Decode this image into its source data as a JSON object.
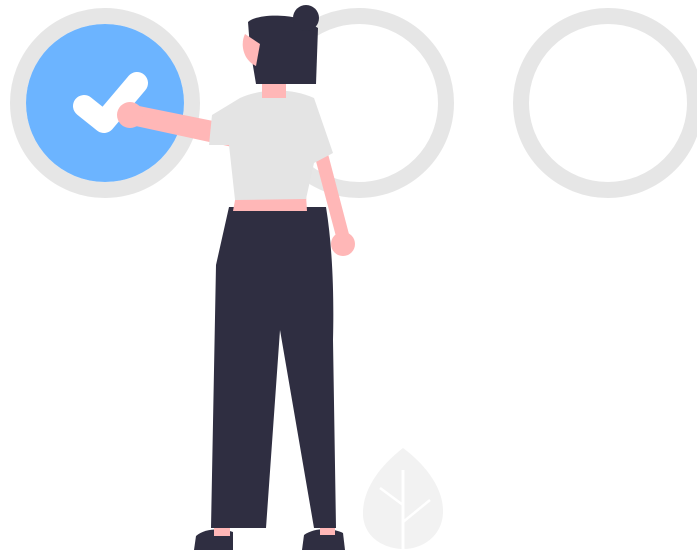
{
  "illustration": {
    "colors": {
      "background": "#ffffff",
      "ring": "#e6e6e6",
      "selected_fill": "#6cb4ff",
      "check": "#ffffff",
      "hair_and_pants": "#2f2e41",
      "skin": "#ffb7b7",
      "shirt": "#e4e4e4",
      "leaf": "#f2f2f2",
      "leaf_vein": "#ffffff",
      "shoe": "#2f2e41"
    },
    "steps": [
      {
        "state": "selected",
        "icon": "checkmark-icon"
      },
      {
        "state": "empty"
      },
      {
        "state": "empty"
      }
    ],
    "figure": {
      "description_icon": "woman-pointing"
    },
    "decoration": {
      "icon": "leaf-icon"
    }
  }
}
